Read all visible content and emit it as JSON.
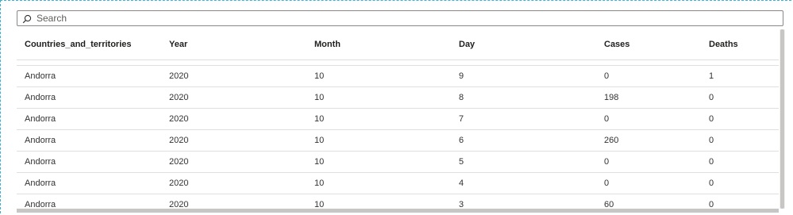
{
  "search": {
    "placeholder": "Search"
  },
  "table": {
    "columns": [
      "Countries_and_territories",
      "Year",
      "Month",
      "Day",
      "Cases",
      "Deaths"
    ],
    "rows": [
      [
        "Andorra",
        "2020",
        "10",
        "9",
        "0",
        "1"
      ],
      [
        "Andorra",
        "2020",
        "10",
        "8",
        "198",
        "0"
      ],
      [
        "Andorra",
        "2020",
        "10",
        "7",
        "0",
        "0"
      ],
      [
        "Andorra",
        "2020",
        "10",
        "6",
        "260",
        "0"
      ],
      [
        "Andorra",
        "2020",
        "10",
        "5",
        "0",
        "0"
      ],
      [
        "Andorra",
        "2020",
        "10",
        "4",
        "0",
        "0"
      ],
      [
        "Andorra",
        "2020",
        "10",
        "3",
        "60",
        "0"
      ]
    ]
  },
  "icons": {
    "search": "search-icon"
  }
}
